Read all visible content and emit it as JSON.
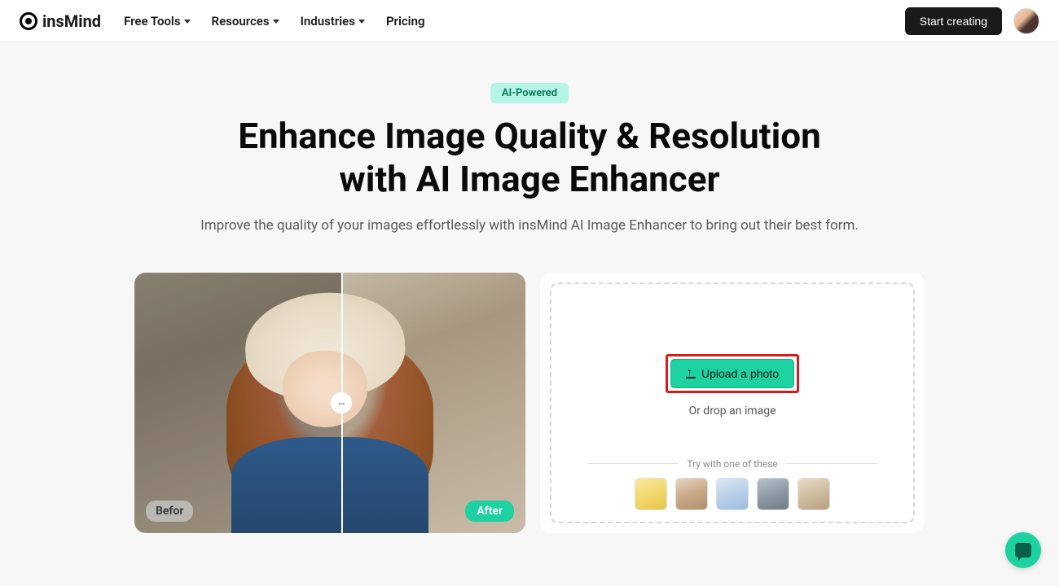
{
  "brand": "insMind",
  "nav": {
    "items": [
      {
        "label": "Free Tools",
        "dropdown": true
      },
      {
        "label": "Resources",
        "dropdown": true
      },
      {
        "label": "Industries",
        "dropdown": true
      },
      {
        "label": "Pricing",
        "dropdown": false
      }
    ]
  },
  "header": {
    "cta": "Start creating"
  },
  "hero": {
    "badge": "AI-Powered",
    "title_line1": "Enhance Image Quality & Resolution",
    "title_line2": "with AI Image Enhancer",
    "subtitle": "Improve the quality of your images effortlessly with insMind AI Image Enhancer to bring out their best form."
  },
  "preview": {
    "before_label": "Befor",
    "after_label": "After"
  },
  "upload": {
    "button": "Upload a photo",
    "drop_text": "Or drop an image",
    "samples_label": "Try with one of these",
    "sample_semantics": [
      "perfume-bottle",
      "woman-portrait",
      "headphones",
      "landscape-boat",
      "statue-face"
    ]
  },
  "colors": {
    "accent_teal": "#1dd1a1",
    "highlight_red": "#d81b1b",
    "badge_bg": "#b5f5e8"
  }
}
